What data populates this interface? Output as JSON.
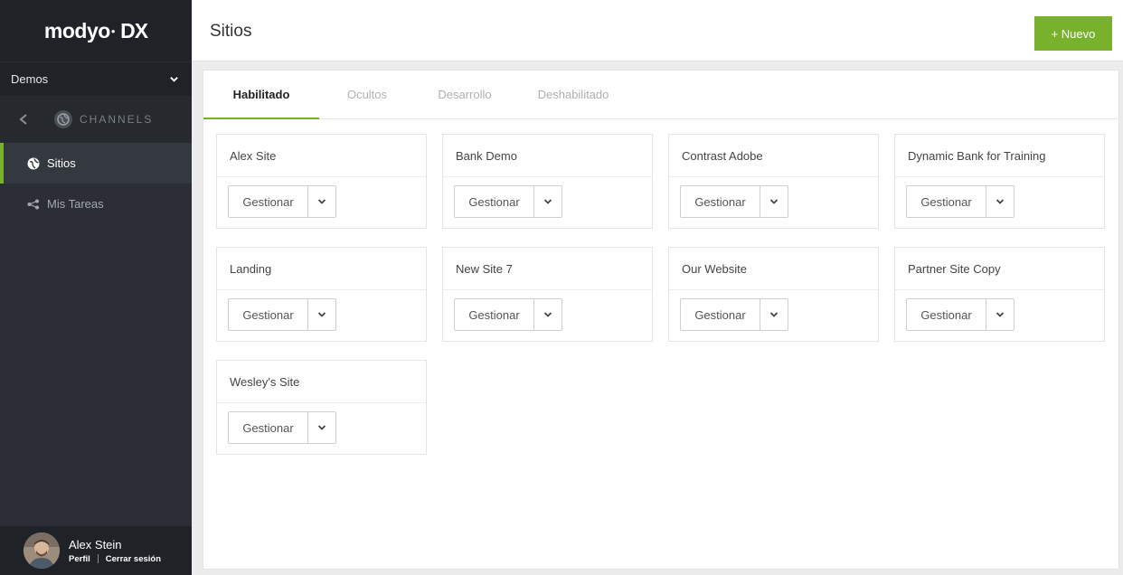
{
  "brand": {
    "logo": "modyo",
    "logo_dx": "DX"
  },
  "sidebar": {
    "org": "Demos",
    "section": "CHANNELS",
    "items": [
      {
        "label": "Sitios",
        "icon": "globe-icon",
        "active": true
      },
      {
        "label": "Mis Tareas",
        "icon": "share-icon",
        "active": false
      }
    ]
  },
  "user": {
    "name": "Alex Stein",
    "profile": "Perfil",
    "logout": "Cerrar sesión"
  },
  "header": {
    "title": "Sitios",
    "new_button": "+ Nuevo"
  },
  "tabs": [
    {
      "label": "Habilitado",
      "active": true
    },
    {
      "label": "Ocultos",
      "active": false
    },
    {
      "label": "Desarrollo",
      "active": false
    },
    {
      "label": "Deshabilitado",
      "active": false
    }
  ],
  "sites": [
    {
      "name": "Alex Site",
      "action": "Gestionar"
    },
    {
      "name": "Bank Demo",
      "action": "Gestionar"
    },
    {
      "name": "Contrast Adobe",
      "action": "Gestionar"
    },
    {
      "name": "Dynamic Bank for Training",
      "action": "Gestionar"
    },
    {
      "name": "Landing",
      "action": "Gestionar"
    },
    {
      "name": "New Site 7",
      "action": "Gestionar"
    },
    {
      "name": "Our Website",
      "action": "Gestionar"
    },
    {
      "name": "Partner Site Copy",
      "action": "Gestionar"
    },
    {
      "name": "Wesley's Site",
      "action": "Gestionar"
    }
  ],
  "colors": {
    "accent": "#78b22d",
    "sidebar": "#2b2f35",
    "sidebar_dark": "#1f2227"
  }
}
